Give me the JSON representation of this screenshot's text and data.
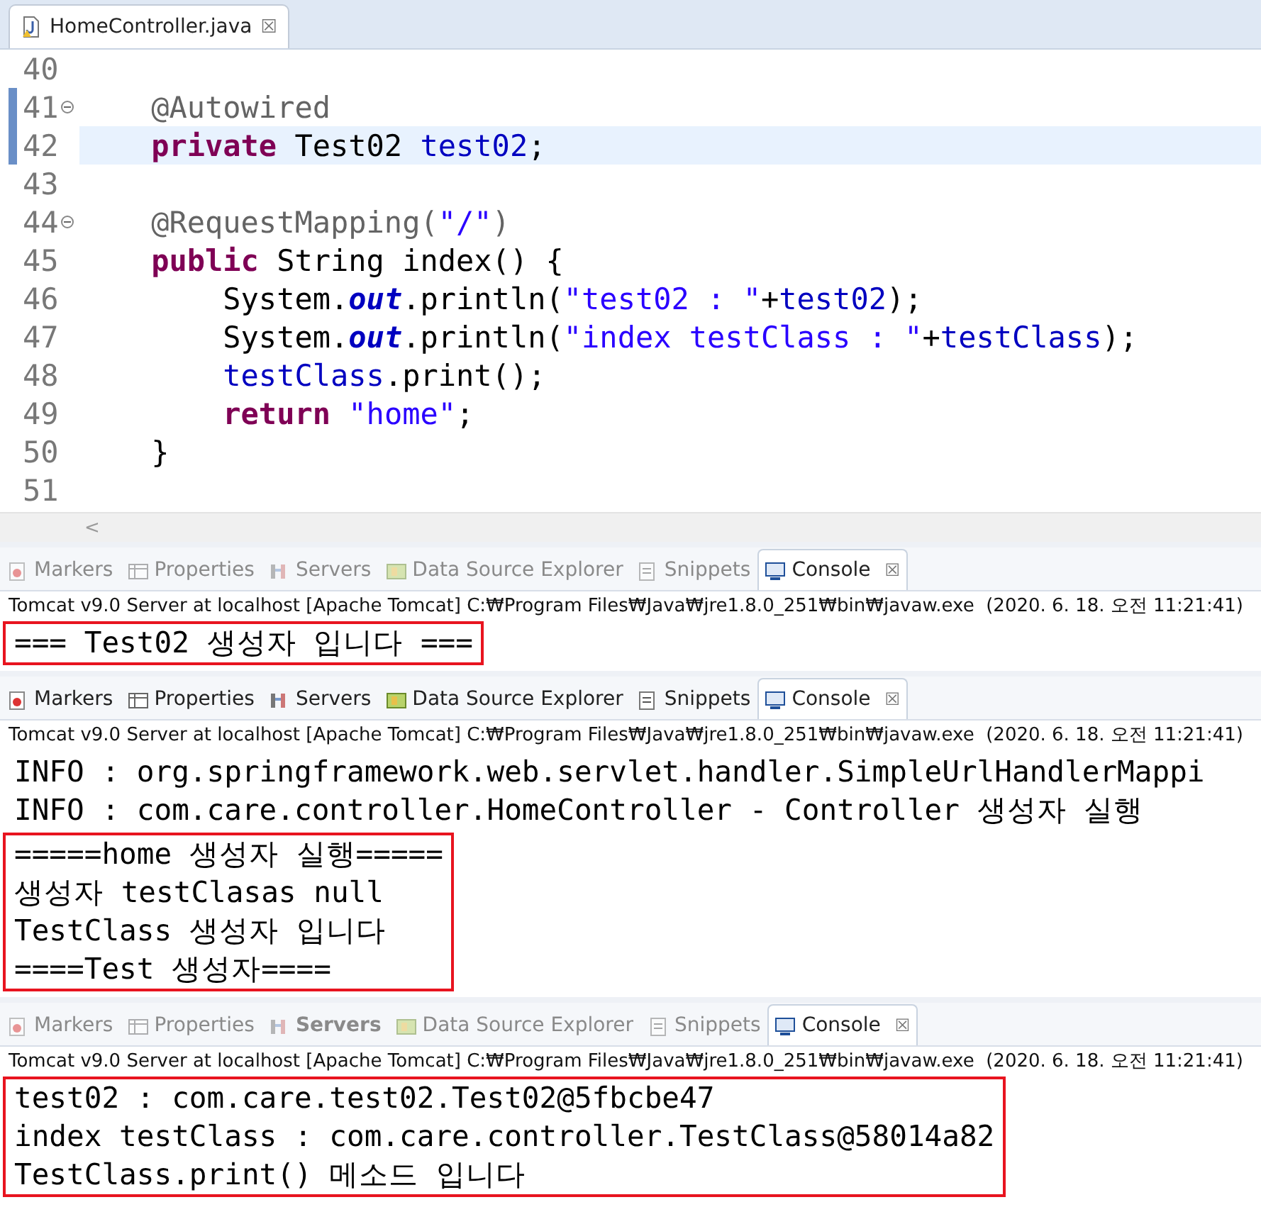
{
  "editor": {
    "tab": {
      "title": "HomeController.java",
      "close": "☒"
    },
    "lines": [
      {
        "number": "40",
        "fold": false,
        "highlighted": false
      },
      {
        "number": "41",
        "fold": true,
        "highlighted": false,
        "tokens": [
          {
            "kind": "annotation",
            "text": "    @Autowired"
          }
        ]
      },
      {
        "number": "42",
        "fold": false,
        "highlighted": true,
        "tokens": [
          {
            "kind": "keyword",
            "text": "    private"
          },
          {
            "kind": "plain",
            "text": " Test02 "
          },
          {
            "kind": "field",
            "text": "test02"
          },
          {
            "kind": "plain",
            "text": ";"
          }
        ]
      },
      {
        "number": "43",
        "fold": false,
        "highlighted": false
      },
      {
        "number": "44",
        "fold": true,
        "highlighted": false,
        "tokens": [
          {
            "kind": "annotation",
            "text": "    @RequestMapping("
          },
          {
            "kind": "string",
            "text": "\"/\""
          },
          {
            "kind": "annotation",
            "text": ")"
          }
        ]
      },
      {
        "number": "45",
        "fold": false,
        "highlighted": false,
        "tokens": [
          {
            "kind": "keyword",
            "text": "    public"
          },
          {
            "kind": "plain",
            "text": " String index() {"
          }
        ]
      },
      {
        "number": "46",
        "fold": false,
        "highlighted": false,
        "tokens": [
          {
            "kind": "plain",
            "text": "        System."
          },
          {
            "kind": "static",
            "text": "out"
          },
          {
            "kind": "plain",
            "text": ".println("
          },
          {
            "kind": "string",
            "text": "\"test02 : \""
          },
          {
            "kind": "plain",
            "text": "+"
          },
          {
            "kind": "field",
            "text": "test02"
          },
          {
            "kind": "plain",
            "text": ");"
          }
        ]
      },
      {
        "number": "47",
        "fold": false,
        "highlighted": false,
        "tokens": [
          {
            "kind": "plain",
            "text": "        System."
          },
          {
            "kind": "static",
            "text": "out"
          },
          {
            "kind": "plain",
            "text": ".println("
          },
          {
            "kind": "string",
            "text": "\"index testClass : \""
          },
          {
            "kind": "plain",
            "text": "+"
          },
          {
            "kind": "field",
            "text": "testClass"
          },
          {
            "kind": "plain",
            "text": ");"
          }
        ]
      },
      {
        "number": "48",
        "fold": false,
        "highlighted": false,
        "tokens": [
          {
            "kind": "field",
            "text": "        testClass"
          },
          {
            "kind": "plain",
            "text": ".print();"
          }
        ]
      },
      {
        "number": "49",
        "fold": false,
        "highlighted": false,
        "tokens": [
          {
            "kind": "keyword",
            "text": "        return"
          },
          {
            "kind": "string",
            "text": " \"home\""
          },
          {
            "kind": "plain",
            "text": ";"
          }
        ]
      },
      {
        "number": "50",
        "fold": false,
        "highlighted": false,
        "tokens": [
          {
            "kind": "plain",
            "text": "    }"
          }
        ]
      },
      {
        "number": "51",
        "fold": false,
        "highlighted": false
      }
    ],
    "scroll_left": "<"
  },
  "consoles": [
    {
      "dimmed": true,
      "tabs": [
        {
          "label": "Markers",
          "selected": false,
          "bold": false
        },
        {
          "label": "Properties",
          "selected": false,
          "bold": false
        },
        {
          "label": "Servers",
          "selected": false,
          "bold": false
        },
        {
          "label": "Data Source Explorer",
          "selected": false,
          "bold": false
        },
        {
          "label": "Snippets",
          "selected": false,
          "bold": false
        },
        {
          "label": "Console",
          "selected": true,
          "bold": false
        }
      ],
      "close": "☒",
      "status": "Tomcat v9.0 Server at localhost [Apache Tomcat] C:₩Program Files₩Java₩jre1.8.0_251₩bin₩javaw.exe  (2020. 6. 18. 오전 11:21:41)",
      "blocks": [
        {
          "boxed": true,
          "lines": [
            "=== Test02 생성자 입니다 ==="
          ]
        }
      ]
    },
    {
      "dimmed": false,
      "tabs": [
        {
          "label": "Markers",
          "selected": false,
          "bold": false
        },
        {
          "label": "Properties",
          "selected": false,
          "bold": false
        },
        {
          "label": "Servers",
          "selected": false,
          "bold": false
        },
        {
          "label": "Data Source Explorer",
          "selected": false,
          "bold": false
        },
        {
          "label": "Snippets",
          "selected": false,
          "bold": false
        },
        {
          "label": "Console",
          "selected": true,
          "bold": false
        }
      ],
      "close": "☒",
      "status": "Tomcat v9.0 Server at localhost [Apache Tomcat] C:₩Program Files₩Java₩jre1.8.0_251₩bin₩javaw.exe  (2020. 6. 18. 오전 11:21:41)",
      "blocks": [
        {
          "boxed": false,
          "lines": [
            "INFO : org.springframework.web.servlet.handler.SimpleUrlHandlerMappi",
            "INFO : com.care.controller.HomeController - Controller 생성자 실행"
          ]
        },
        {
          "boxed": true,
          "lines": [
            "=====home 생성자 실행=====",
            "생성자 testClasas null",
            "TestClass 생성자 입니다",
            "====Test 생성자===="
          ]
        }
      ]
    },
    {
      "dimmed": true,
      "tabs": [
        {
          "label": "Markers",
          "selected": false,
          "bold": false
        },
        {
          "label": "Properties",
          "selected": false,
          "bold": false
        },
        {
          "label": "Servers",
          "selected": false,
          "bold": true
        },
        {
          "label": "Data Source Explorer",
          "selected": false,
          "bold": false
        },
        {
          "label": "Snippets",
          "selected": false,
          "bold": false
        },
        {
          "label": "Console",
          "selected": true,
          "bold": false
        }
      ],
      "close": "☒",
      "status": "Tomcat v9.0 Server at localhost [Apache Tomcat] C:₩Program Files₩Java₩jre1.8.0_251₩bin₩javaw.exe  (2020. 6. 18. 오전 11:21:41)",
      "blocks": [
        {
          "boxed": true,
          "lines": [
            "test02 : com.care.test02.Test02@5fbcbe47",
            "index testClass : com.care.controller.TestClass@58014a82",
            "TestClass.print() 메소드 입니다"
          ]
        }
      ]
    }
  ]
}
